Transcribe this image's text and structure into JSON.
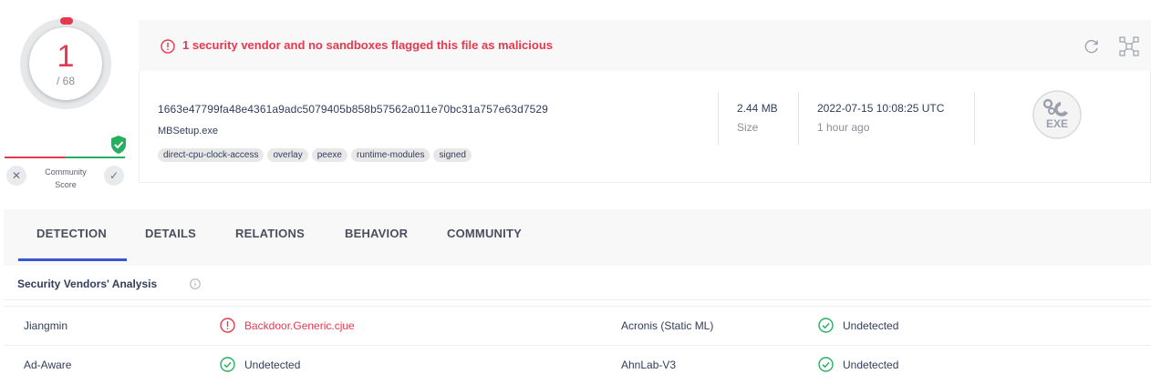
{
  "score": {
    "detections": "1",
    "total": "/ 68",
    "community_label": "Community Score"
  },
  "alert": {
    "text": "1 security vendor and no sandboxes flagged this file as malicious"
  },
  "file": {
    "hash": "1663e47799fa48e4361a9adc5079405b858b57562a011e70bc31a757e63d7529",
    "name": "MBSetup.exe",
    "tags": [
      "direct-cpu-clock-access",
      "overlay",
      "peexe",
      "runtime-modules",
      "signed"
    ],
    "size_value": "2.44 MB",
    "size_label": "Size",
    "date_value": "2022-07-15 10:08:25 UTC",
    "date_label": "1 hour ago",
    "type_icon": "exe-file-icon",
    "type_text": "EXE"
  },
  "tabs": [
    "DETECTION",
    "DETAILS",
    "RELATIONS",
    "BEHAVIOR",
    "COMMUNITY"
  ],
  "analysis": {
    "title": "Security Vendors' Analysis",
    "rows": [
      {
        "vendor_a": "Jiangmin",
        "result_a": "Backdoor.Generic.cjue",
        "vendor_b": "Acronis (Static ML)",
        "result_b": "Undetected"
      },
      {
        "vendor_a": "Ad-Aware",
        "result_a": "Undetected",
        "vendor_b": "AhnLab-V3",
        "result_b": "Undetected"
      }
    ]
  },
  "colors": {
    "malicious": "#e8384f",
    "clean": "#27ae60",
    "accent": "#3a55d4"
  }
}
